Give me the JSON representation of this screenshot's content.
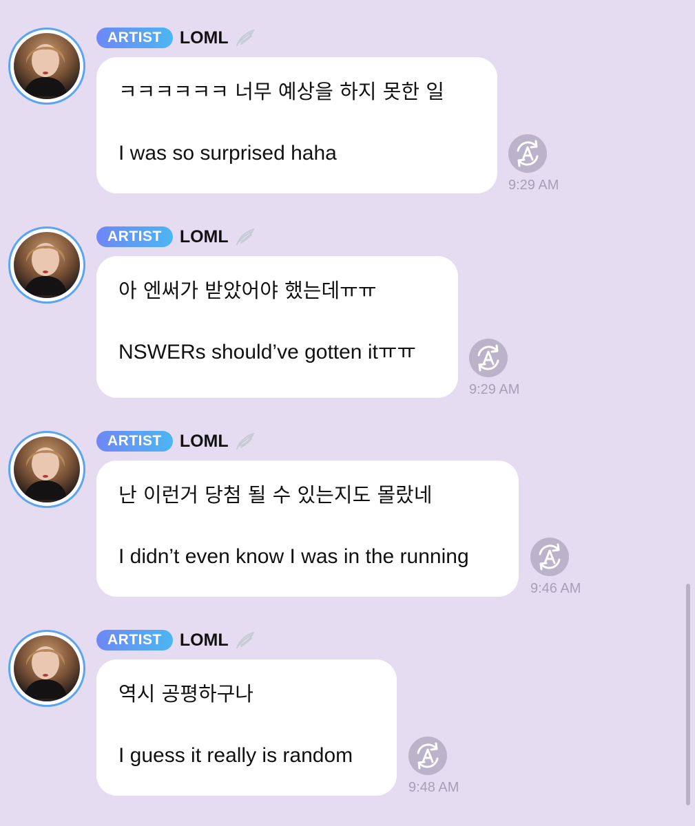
{
  "messages": [
    {
      "badge": "ARTIST",
      "name": "LOML",
      "korean": "ㅋㅋㅋㅋㅋㅋ 너무 예상을 하지 못한 일",
      "english": "I was so surprised haha",
      "time": "9:29 AM"
    },
    {
      "badge": "ARTIST",
      "name": "LOML",
      "korean": "아 엔써가 받았어야 했는데ㅠㅠ",
      "english": "NSWERs should’ve gotten itㅠㅠ",
      "time": "9:29 AM"
    },
    {
      "badge": "ARTIST",
      "name": "LOML",
      "korean": "난 이런거 당첨 될 수 있는지도 몰랐네",
      "english": "I didn’t even know I was in the running",
      "time": "9:46 AM"
    },
    {
      "badge": "ARTIST",
      "name": "LOML",
      "korean": "역시 공평하구나",
      "english": "I guess it really is random",
      "time": "9:48 AM"
    }
  ],
  "icons": {
    "badge_icon": "wing-icon",
    "translate_icon": "translate-refresh-icon",
    "avatar": "avatar-photo"
  },
  "colors": {
    "background": "#e6dcf1",
    "badge_gradient_start": "#6f87f5",
    "badge_gradient_end": "#4bb6f2",
    "avatar_ring": "#5aa4f0",
    "timestamp": "#a89fb6",
    "translate_button": "#bbb3c9"
  }
}
